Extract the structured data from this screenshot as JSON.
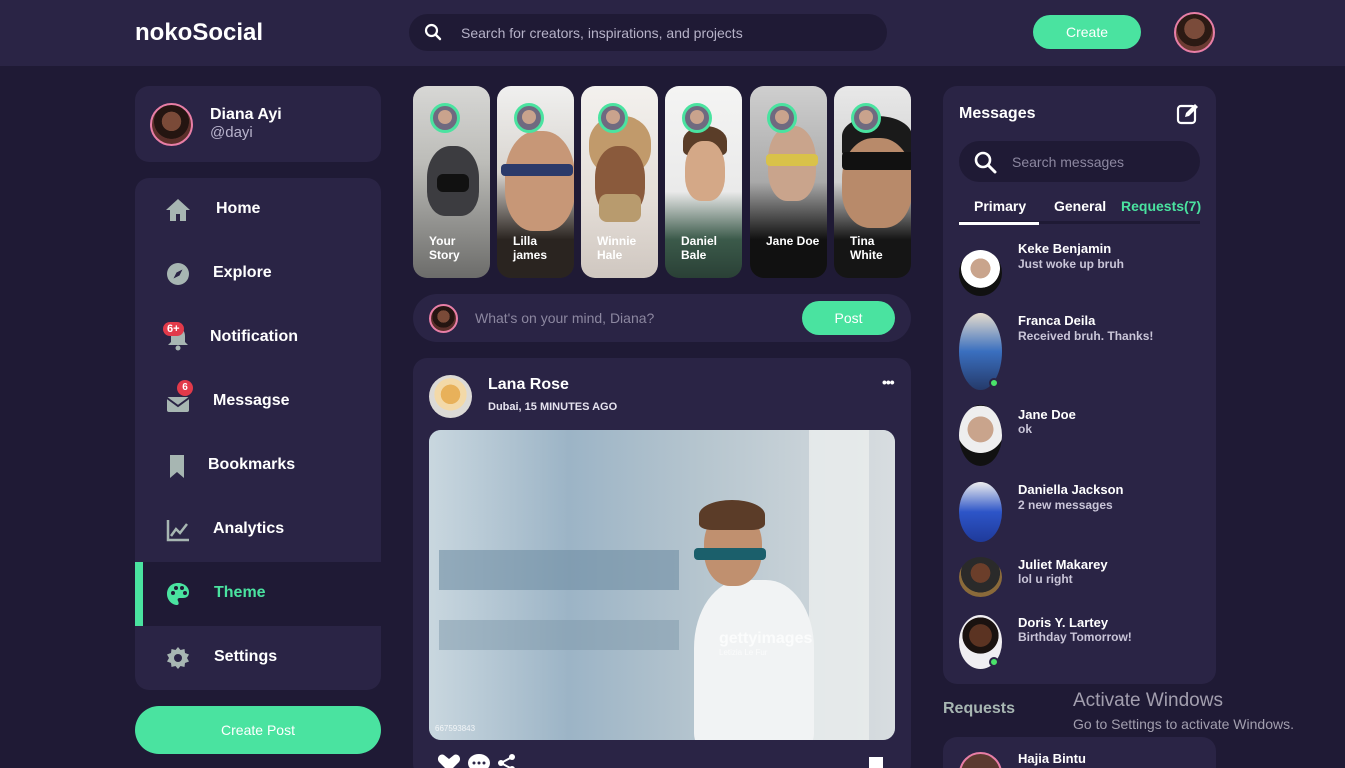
{
  "navbar": {
    "logo": "nokoSocial",
    "search_placeholder": "Search for creators, inspirations, and projects",
    "create_label": "Create"
  },
  "profile": {
    "name": "Diana Ayi",
    "handle": "@dayi"
  },
  "sidebar": {
    "items": [
      {
        "label": "Home",
        "icon": "home-icon"
      },
      {
        "label": "Explore",
        "icon": "compass-icon"
      },
      {
        "label": "Notification",
        "icon": "bell-icon",
        "badge": "6+"
      },
      {
        "label": "Messagse",
        "icon": "envelope-icon",
        "badge": "6"
      },
      {
        "label": "Bookmarks",
        "icon": "bookmark-icon"
      },
      {
        "label": "Analytics",
        "icon": "chart-line-icon"
      },
      {
        "label": "Theme",
        "icon": "palette-icon",
        "active": true
      },
      {
        "label": "Settings",
        "icon": "gear-icon"
      }
    ],
    "create_post_label": "Create Post"
  },
  "stories": [
    {
      "name": "Your Story"
    },
    {
      "name": "Lilla james"
    },
    {
      "name": "Winnie Hale"
    },
    {
      "name": "Daniel Bale"
    },
    {
      "name": "Jane Doe"
    },
    {
      "name": "Tina White"
    }
  ],
  "composer": {
    "placeholder": "What's on your mind, Diana?",
    "post_label": "Post"
  },
  "feed": {
    "author": "Lana Rose",
    "meta": "Dubai, 15 MINUTES AGO",
    "more": "•••",
    "image_watermark": "gettyimages",
    "image_credit": "Letizia Le Fur",
    "image_id": "667593843"
  },
  "messages": {
    "title": "Messages",
    "search_placeholder": "Search messages",
    "tabs": [
      "Primary",
      "General",
      "Requests(7)"
    ],
    "items": [
      {
        "name": "Keke Benjamin",
        "text": "Just woke up bruh"
      },
      {
        "name": "Franca Deila",
        "text": "Received bruh. Thanks!"
      },
      {
        "name": "Jane Doe",
        "text": "ok"
      },
      {
        "name": "Daniella Jackson",
        "text": "2 new messages"
      },
      {
        "name": "Juliet Makarey",
        "text": "lol u right"
      },
      {
        "name": "Doris Y. Lartey",
        "text": "Birthday Tomorrow!"
      }
    ]
  },
  "requests": {
    "title": "Requests",
    "first_name": "Hajia Bintu"
  },
  "watermark": {
    "line1": "Activate Windows",
    "line2": "Go to Settings to activate Windows."
  },
  "colors": {
    "accent": "#4ae3a0",
    "background": "#1f1a35",
    "card": "#2a2445",
    "badge": "#e23a4a"
  }
}
